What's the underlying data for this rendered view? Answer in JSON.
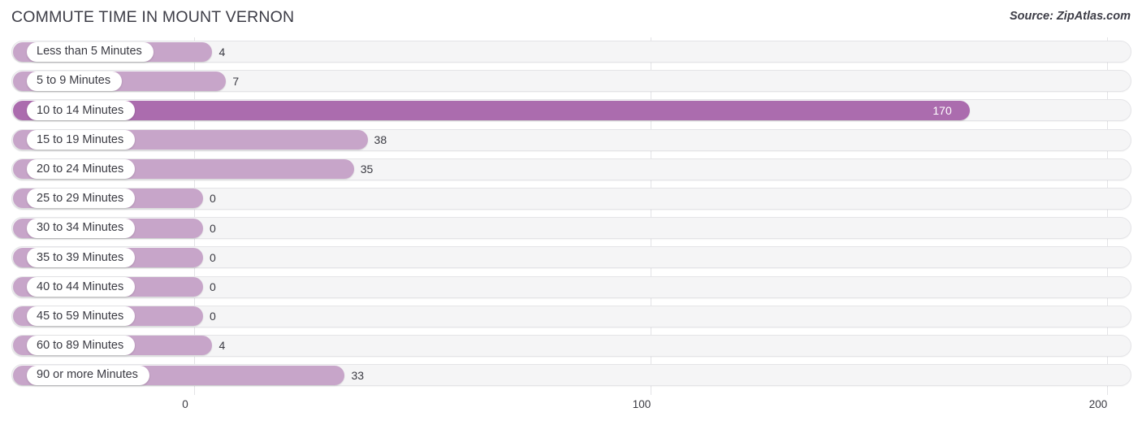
{
  "header": {
    "title": "COMMUTE TIME IN MOUNT VERNON",
    "source": "Source: ZipAtlas.com"
  },
  "colors": {
    "bar": "#c7a5c9",
    "bar_highlight": "#ab6cae",
    "track": "#f5f5f6",
    "gridline": "#e3e3e6",
    "text": "#3a3a42"
  },
  "chart_data": {
    "type": "bar",
    "orientation": "horizontal",
    "title": "COMMUTE TIME IN MOUNT VERNON",
    "xlabel": "",
    "ylabel": "",
    "xlim": [
      0,
      200
    ],
    "xticks": [
      0,
      100,
      200
    ],
    "xtick_labels": [
      "0",
      "100",
      "200"
    ],
    "grid": true,
    "legend": null,
    "categories": [
      "Less than 5 Minutes",
      "5 to 9 Minutes",
      "10 to 14 Minutes",
      "15 to 19 Minutes",
      "20 to 24 Minutes",
      "25 to 29 Minutes",
      "30 to 34 Minutes",
      "35 to 39 Minutes",
      "40 to 44 Minutes",
      "45 to 59 Minutes",
      "60 to 89 Minutes",
      "90 or more Minutes"
    ],
    "values": [
      4,
      7,
      170,
      38,
      35,
      0,
      0,
      0,
      0,
      0,
      4,
      33
    ],
    "value_labels": [
      "4",
      "7",
      "170",
      "38",
      "35",
      "0",
      "0",
      "0",
      "0",
      "0",
      "4",
      "33"
    ],
    "highlight_index": 2
  }
}
